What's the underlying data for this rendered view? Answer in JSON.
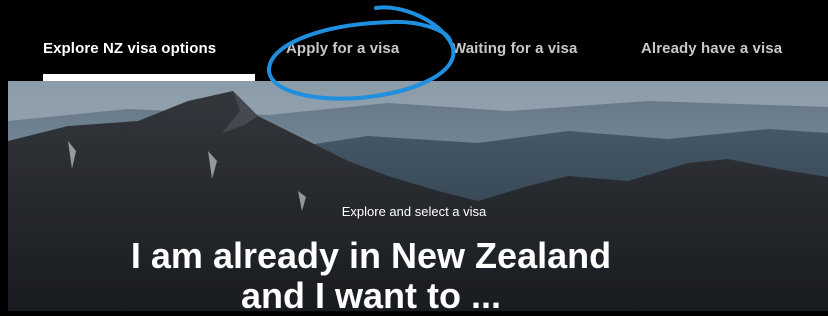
{
  "nav": {
    "items": [
      {
        "label": "Explore NZ visa options",
        "active": true
      },
      {
        "label": "Apply for a visa",
        "active": false
      },
      {
        "label": "Waiting for a visa",
        "active": false
      },
      {
        "label": "Already have a visa",
        "active": false
      }
    ]
  },
  "hero": {
    "eyebrow": "Explore and select a visa",
    "headline_line1": "I am already in New Zealand",
    "headline_line2": "and I want to ..."
  },
  "colors": {
    "nav_background": "#000000",
    "text": "#ffffff",
    "annotation_circle": "#1f8fe0"
  }
}
